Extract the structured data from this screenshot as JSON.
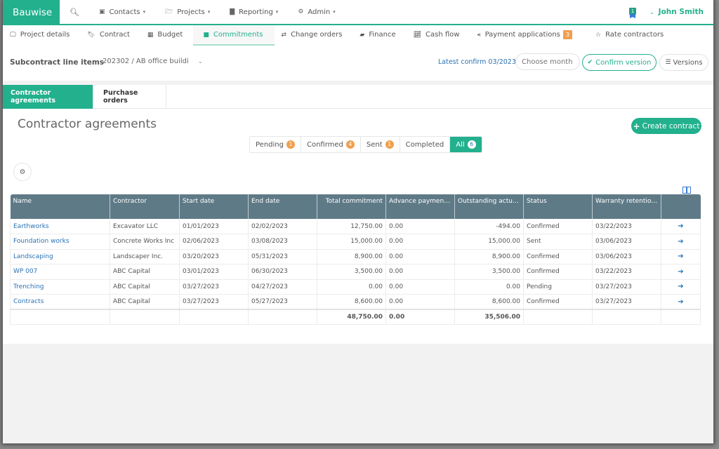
{
  "app": {
    "brand": "Bauwise",
    "accent_color": "#22b08d",
    "link_color": "#2a72b5",
    "badge_color": "#f0a050",
    "header_color": "#5f7a87"
  },
  "topnav": {
    "items": [
      {
        "label": "Contacts",
        "icon": "address-card-icon"
      },
      {
        "label": "Projects",
        "icon": "folder-open-icon"
      },
      {
        "label": "Reporting",
        "icon": "bar-chart-icon"
      },
      {
        "label": "Admin",
        "icon": "gear-icon"
      }
    ],
    "notification_count": "1",
    "user_name": "John Smith"
  },
  "subnav": {
    "tabs": [
      {
        "label": "Project details",
        "icon": "desktop-icon"
      },
      {
        "label": "Contract",
        "icon": "bookmark-icon"
      },
      {
        "label": "Budget",
        "icon": "calculator-icon"
      },
      {
        "label": "Commitments",
        "icon": "inbox-icon",
        "active": true
      },
      {
        "label": "Change orders",
        "icon": "retweet-icon"
      },
      {
        "label": "Finance",
        "icon": "book-icon"
      },
      {
        "label": "Cash flow",
        "icon": "line-chart-icon"
      },
      {
        "label": "Payment applications",
        "icon": "share-icon",
        "count": "3"
      },
      {
        "label": "Rate contractors",
        "icon": "star-half-icon"
      }
    ]
  },
  "toolbar": {
    "label": "Subcontract line items",
    "project": "202302 / AB office buildi",
    "latest_confirm": "Latest confirm 03/2023",
    "choose_month_placeholder": "Choose month",
    "confirm_version": "Confirm version",
    "versions": "Versions"
  },
  "panel": {
    "tabs": [
      {
        "label": "Contractor agreements",
        "active": true
      },
      {
        "label": "Purchase orders"
      }
    ],
    "title": "Contractor agreements",
    "create_button": "Create contract",
    "filters": [
      {
        "label": "Pending",
        "count": "1"
      },
      {
        "label": "Confirmed",
        "count": "4"
      },
      {
        "label": "Sent",
        "count": "1"
      },
      {
        "label": "Completed",
        "count": ""
      },
      {
        "label": "All",
        "count": "6",
        "active": true
      }
    ]
  },
  "table": {
    "columns": [
      "Name",
      "Contractor",
      "Start date",
      "End date",
      "Total commitment",
      "Advance payment ba...",
      "Outstanding actuals",
      "Status",
      "Warranty retention e...",
      ""
    ],
    "rows": [
      {
        "name": "Earthworks",
        "contractor": "Excavator LLC",
        "start": "01/01/2023",
        "end": "02/02/2023",
        "total": "12,750.00",
        "advance": "0.00",
        "outstanding": "-494.00",
        "status": "Confirmed",
        "warranty": "03/22/2023"
      },
      {
        "name": "Foundation works",
        "contractor": "Concrete Works Inc",
        "start": "02/06/2023",
        "end": "03/08/2023",
        "total": "15,000.00",
        "advance": "0.00",
        "outstanding": "15,000.00",
        "status": "Sent",
        "warranty": "03/06/2023"
      },
      {
        "name": "Landscaping",
        "contractor": "Landscaper Inc.",
        "start": "03/20/2023",
        "end": "05/31/2023",
        "total": "8,900.00",
        "advance": "0.00",
        "outstanding": "8,900.00",
        "status": "Confirmed",
        "warranty": "03/06/2023"
      },
      {
        "name": "WP 007",
        "contractor": "ABC Capital",
        "start": "03/01/2023",
        "end": "06/30/2023",
        "total": "3,500.00",
        "advance": "0.00",
        "outstanding": "3,500.00",
        "status": "Confirmed",
        "warranty": "03/22/2023"
      },
      {
        "name": "Trenching",
        "contractor": "ABC Capital",
        "start": "03/27/2023",
        "end": "04/27/2023",
        "total": "0.00",
        "advance": "0.00",
        "outstanding": "0.00",
        "status": "Pending",
        "warranty": "03/27/2023"
      },
      {
        "name": "Contracts",
        "contractor": "ABC Capital",
        "start": "03/27/2023",
        "end": "05/27/2023",
        "total": "8,600.00",
        "advance": "0.00",
        "outstanding": "8,600.00",
        "status": "Confirmed",
        "warranty": "03/27/2023"
      }
    ],
    "totals": {
      "total": "48,750.00",
      "advance": "0.00",
      "outstanding": "35,506.00"
    }
  }
}
